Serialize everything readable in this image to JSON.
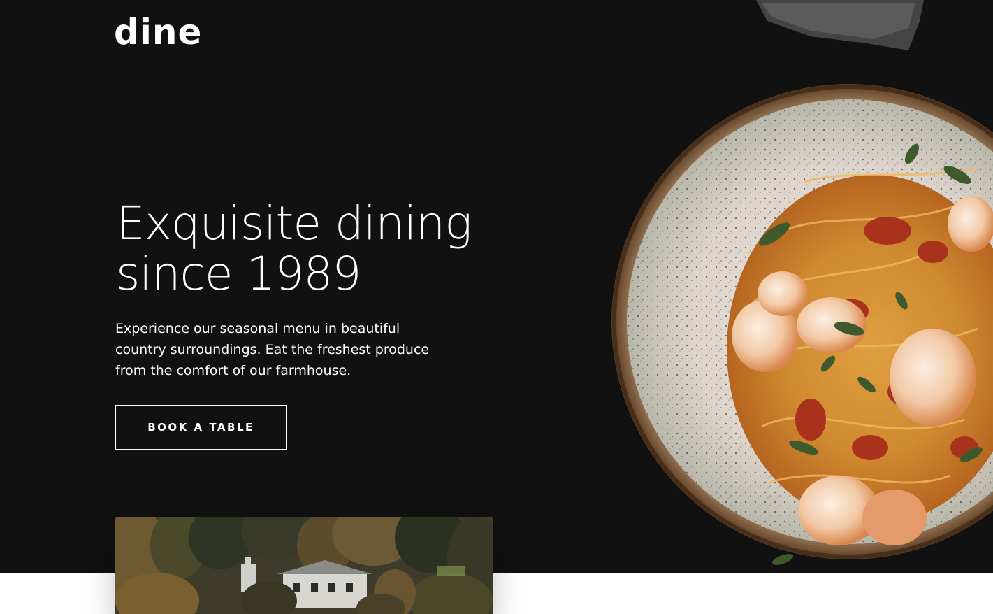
{
  "header": {
    "logo": "dine"
  },
  "hero": {
    "title_line1": "Exquisite dining",
    "title_line2": "since 1989",
    "description": "Experience our seasonal menu in beautiful country surroundings. Eat the freshest produce from the comfort of our farmhouse.",
    "cta_label": "BOOK A TABLE"
  },
  "images": {
    "hero_dish": "plate of shrimp spaghetti",
    "venue": "farmhouse among trees"
  },
  "colors": {
    "hero_background": "#111111",
    "text": "#ffffff",
    "page_background": "#ffffff"
  }
}
